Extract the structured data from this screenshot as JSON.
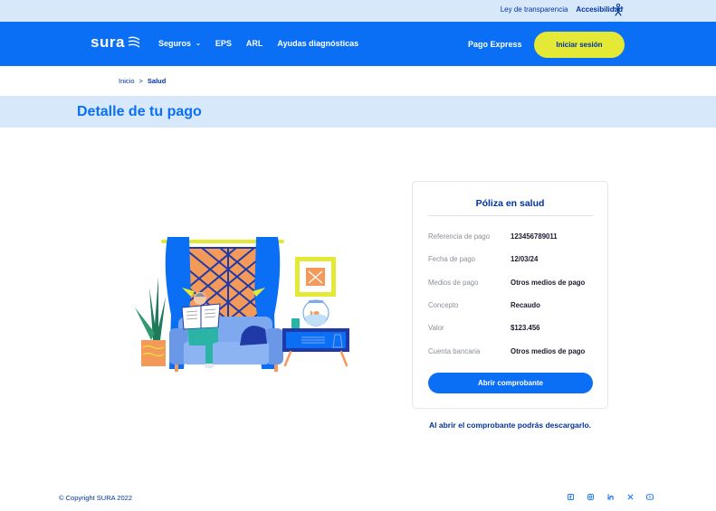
{
  "topbar": {
    "transparency_link": "Ley de transparencia",
    "accessibility_link": "Accesibilidad",
    "accessibility_icon": "accessibility-person-icon"
  },
  "header": {
    "logo_text": "sura",
    "nav": [
      {
        "label": "Seguros",
        "has_dropdown": true
      },
      {
        "label": "EPS",
        "has_dropdown": false
      },
      {
        "label": "ARL",
        "has_dropdown": false
      },
      {
        "label": "Ayudas diagnósticas",
        "has_dropdown": false
      }
    ],
    "pago_express": "Pago Express",
    "login_label": "Iniciar sesión"
  },
  "breadcrumb": {
    "home": "Inicio",
    "separator": ">",
    "current": "Salud"
  },
  "page_title": "Detalle de tu pago",
  "card": {
    "title": "Póliza en salud",
    "rows": [
      {
        "label": "Referencia de pago",
        "value": "123456789011"
      },
      {
        "label": "Fecha de pago",
        "value": "12/03/24"
      },
      {
        "label": "Medios de pago",
        "value": "Otros medios de pago"
      },
      {
        "label": "Concepto",
        "value": "Recaudo"
      },
      {
        "label": "Valor",
        "value": "$123.456"
      },
      {
        "label": "Cuenta bancaria",
        "value": "Otros medios de pago"
      }
    ],
    "button_label": "Abrir comprobante"
  },
  "note": "Al abrir el comprobante podrás descargarlo.",
  "footer": {
    "copyright": "© Copyright SURA 2022",
    "social_icons": [
      "facebook-icon",
      "instagram-icon",
      "linkedin-icon",
      "x-icon",
      "youtube-icon"
    ]
  },
  "colors": {
    "primary": "#0a6ff5",
    "navy": "#0033a0",
    "accent_yellow": "#e3e934",
    "light_band": "#d7e8fb"
  }
}
